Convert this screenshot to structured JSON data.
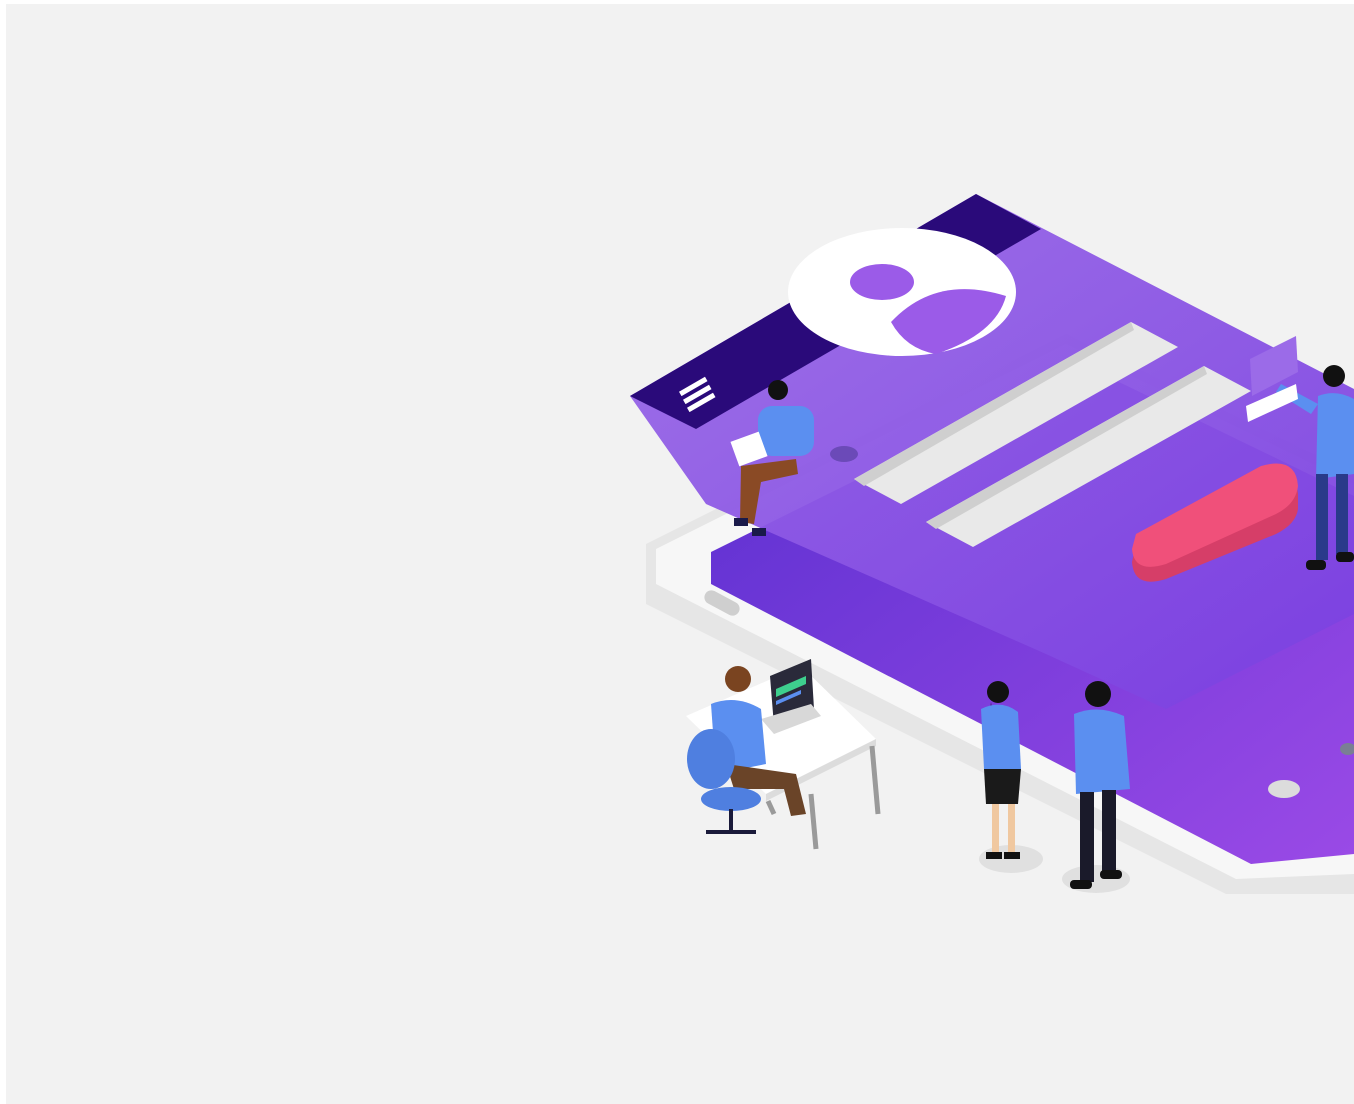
{
  "scene": {
    "description_icon": "isometric-login-illustration",
    "colors": {
      "background": "#f2f2f2",
      "screen_purple": "#8a4fe6",
      "header_dark": "#2a0a7a",
      "login_button": "#f0507a",
      "avatar_circle": "#ffffff",
      "person_shirt": "#5b8ff0"
    }
  }
}
